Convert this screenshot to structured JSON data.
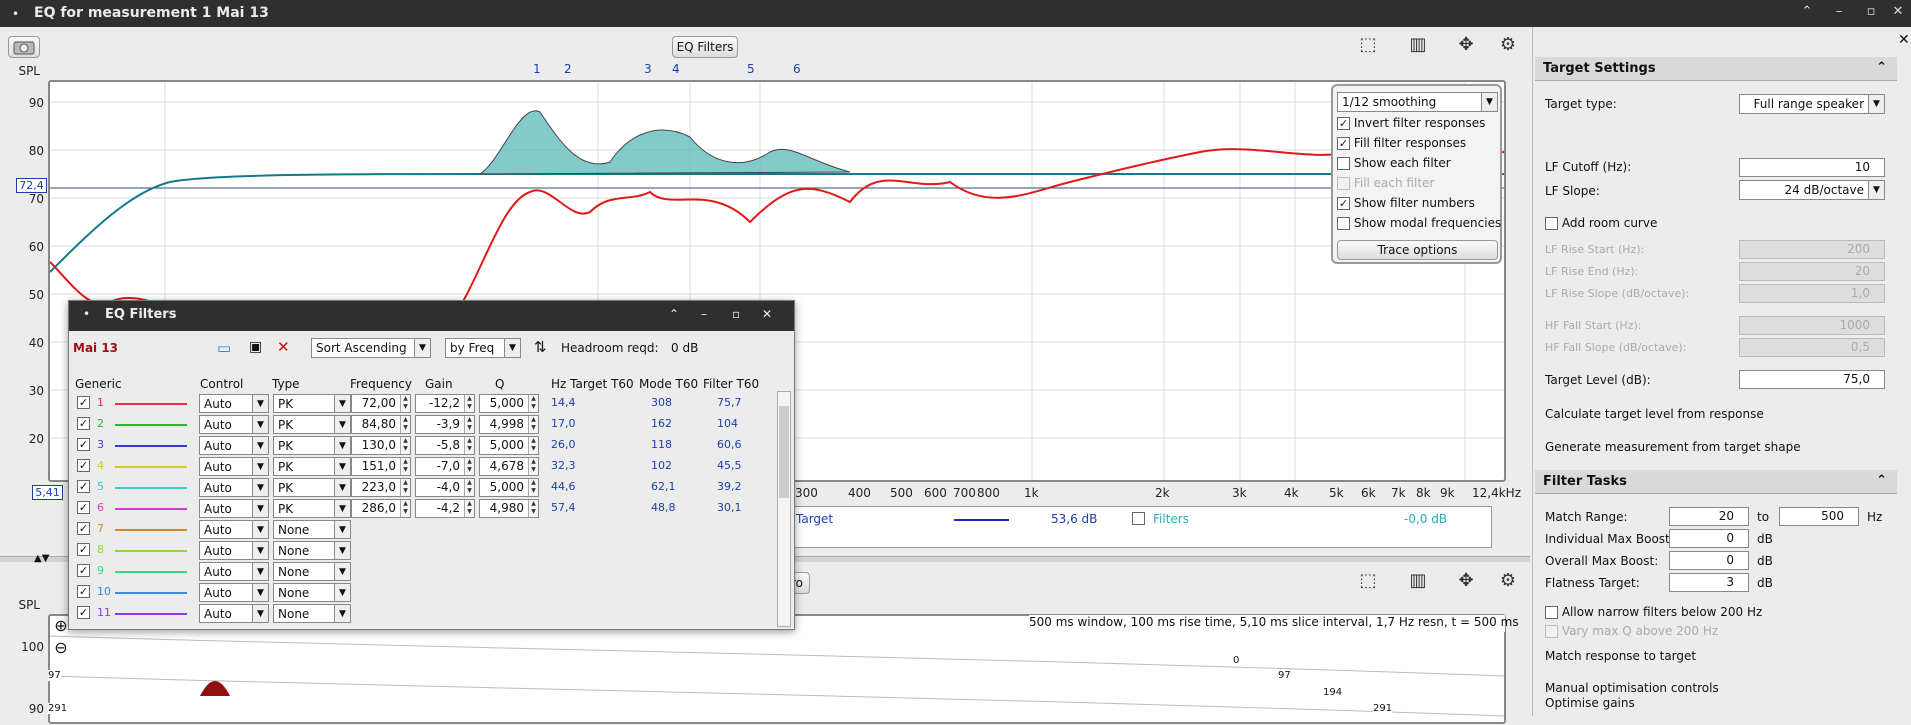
{
  "window": {
    "title": "EQ for measurement 1 Mai 13"
  },
  "toolbar": {
    "eq_filters_button": "EQ Filters"
  },
  "plot": {
    "y_axis_label": "SPL",
    "y_ticks": [
      "90",
      "80",
      "70",
      "60",
      "50",
      "40",
      "30",
      "20"
    ],
    "x_ticks": [
      "300",
      "400",
      "500",
      "600",
      "700",
      "800",
      "1k",
      "2k",
      "3k",
      "4k",
      "5k",
      "6k",
      "7k",
      "8k",
      "9k",
      "12,4kHz"
    ],
    "cursor_y_value": "72,4",
    "cursor_bottom_value": "5,41",
    "filter_numbers": [
      "1",
      "2",
      "3",
      "4",
      "5",
      "6"
    ]
  },
  "trace_options": {
    "smoothing": "1/12 smoothing",
    "options": [
      {
        "label": "Invert filter responses",
        "checked": true,
        "enabled": true
      },
      {
        "label": "Fill filter responses",
        "checked": true,
        "enabled": true
      },
      {
        "label": "Show each filter",
        "checked": false,
        "enabled": true
      },
      {
        "label": "Fill each filter",
        "checked": false,
        "enabled": false
      },
      {
        "label": "Show filter numbers",
        "checked": true,
        "enabled": true
      },
      {
        "label": "Show modal frequencies",
        "checked": false,
        "enabled": true
      }
    ],
    "button": "Trace options"
  },
  "legend": {
    "target_label": "Target",
    "target_value": "53,6 dB",
    "filters_label": "Filters",
    "filters_value": "-0,0 dB"
  },
  "eq_dialog": {
    "title": "EQ Filters",
    "measurement": "Mai 13",
    "sort": "Sort Ascending",
    "sort_by": "by Freq",
    "headroom_label": "Headroom reqd:",
    "headroom_value": "0 dB",
    "headers": {
      "generic": "Generic",
      "control": "Control",
      "type": "Type",
      "frequency": "Frequency",
      "gain": "Gain",
      "q": "Q",
      "hz_target_t60": "Hz  Target T60",
      "mode_t60": "Mode T60",
      "filter_t60": "Filter T60"
    },
    "filters": [
      {
        "num": "1",
        "color": "#e8303a",
        "control": "Auto",
        "type": "PK",
        "freq": "72,00",
        "gain": "-12,2",
        "q": "5,000",
        "target_t60": "14,4",
        "mode_t60": "308",
        "filter_t60": "75,7"
      },
      {
        "num": "2",
        "color": "#2fb52f",
        "control": "Auto",
        "type": "PK",
        "freq": "84,80",
        "gain": "-3,9",
        "q": "4,998",
        "target_t60": "17,0",
        "mode_t60": "162",
        "filter_t60": "104"
      },
      {
        "num": "3",
        "color": "#3a3ad0",
        "control": "Auto",
        "type": "PK",
        "freq": "130,0",
        "gain": "-5,8",
        "q": "5,000",
        "target_t60": "26,0",
        "mode_t60": "118",
        "filter_t60": "60,6"
      },
      {
        "num": "4",
        "color": "#d8c33a",
        "control": "Auto",
        "type": "PK",
        "freq": "151,0",
        "gain": "-7,0",
        "q": "4,678",
        "target_t60": "32,3",
        "mode_t60": "102",
        "filter_t60": "45,5"
      },
      {
        "num": "5",
        "color": "#3ac8d0",
        "control": "Auto",
        "type": "PK",
        "freq": "223,0",
        "gain": "-4,0",
        "q": "5,000",
        "target_t60": "44,6",
        "mode_t60": "62,1",
        "filter_t60": "39,2"
      },
      {
        "num": "6",
        "color": "#d23ad2",
        "control": "Auto",
        "type": "PK",
        "freq": "286,0",
        "gain": "-4,2",
        "q": "4,980",
        "target_t60": "57,4",
        "mode_t60": "48,8",
        "filter_t60": "30,1"
      },
      {
        "num": "7",
        "color": "#d8882a",
        "control": "Auto",
        "type": "None"
      },
      {
        "num": "8",
        "color": "#8ad83a",
        "control": "Auto",
        "type": "None"
      },
      {
        "num": "9",
        "color": "#3ad88a",
        "control": "Auto",
        "type": "None"
      },
      {
        "num": "10",
        "color": "#3a8ad8",
        "control": "Auto",
        "type": "None"
      },
      {
        "num": "11",
        "color": "#8a3ad8",
        "control": "Auto",
        "type": "None"
      }
    ]
  },
  "right_panel": {
    "target_settings": {
      "title": "Target Settings",
      "target_type_label": "Target type:",
      "target_type": "Full range speaker",
      "lf_cutoff_label": "LF Cutoff (Hz):",
      "lf_cutoff": "10",
      "lf_slope_label": "LF Slope:",
      "lf_slope": "24 dB/octave",
      "add_room_curve": "Add room curve",
      "lf_rise_start_label": "LF Rise Start (Hz):",
      "lf_rise_start": "200",
      "lf_rise_end_label": "LF Rise End (Hz):",
      "lf_rise_end": "20",
      "lf_rise_slope_label": "LF Rise Slope (dB/octave):",
      "lf_rise_slope": "1,0",
      "hf_fall_start_label": "HF Fall Start (Hz):",
      "hf_fall_start": "1000",
      "hf_fall_slope_label": "HF Fall Slope (dB/octave):",
      "hf_fall_slope": "0,5",
      "target_level_label": "Target Level (dB):",
      "target_level": "75,0",
      "calc_target": "Calculate target level from response",
      "gen_measurement": "Generate measurement from target shape"
    },
    "filter_tasks": {
      "title": "Filter Tasks",
      "match_range_label": "Match Range:",
      "match_from": "20",
      "to_label": "to",
      "match_to": "500",
      "hz_unit": "Hz",
      "indiv_max_boost_label": "Individual Max Boost:",
      "indiv_max_boost": "0",
      "overall_max_boost_label": "Overall Max Boost:",
      "overall_max_boost": "0",
      "flatness_target_label": "Flatness Target:",
      "flatness_target": "3",
      "db_unit": "dB",
      "allow_narrow": "Allow narrow filters below 200 Hz",
      "vary_max_q": "Vary max Q above 200 Hz",
      "match_response": "Match response to target",
      "manual_opt": "Manual optimisation controls",
      "optimise_gains": "Optimise gains"
    }
  },
  "lower_plot": {
    "y_axis_label": "SPL",
    "y_ticks": [
      "100",
      "90"
    ],
    "info": "500 ms window, 100 ms rise time, 5,10 ms slice interval, 1,7 Hz resn, t = 500 ms",
    "labels": [
      "97",
      "291",
      "0",
      "97",
      "194",
      "291"
    ],
    "partial_button": "ro"
  }
}
